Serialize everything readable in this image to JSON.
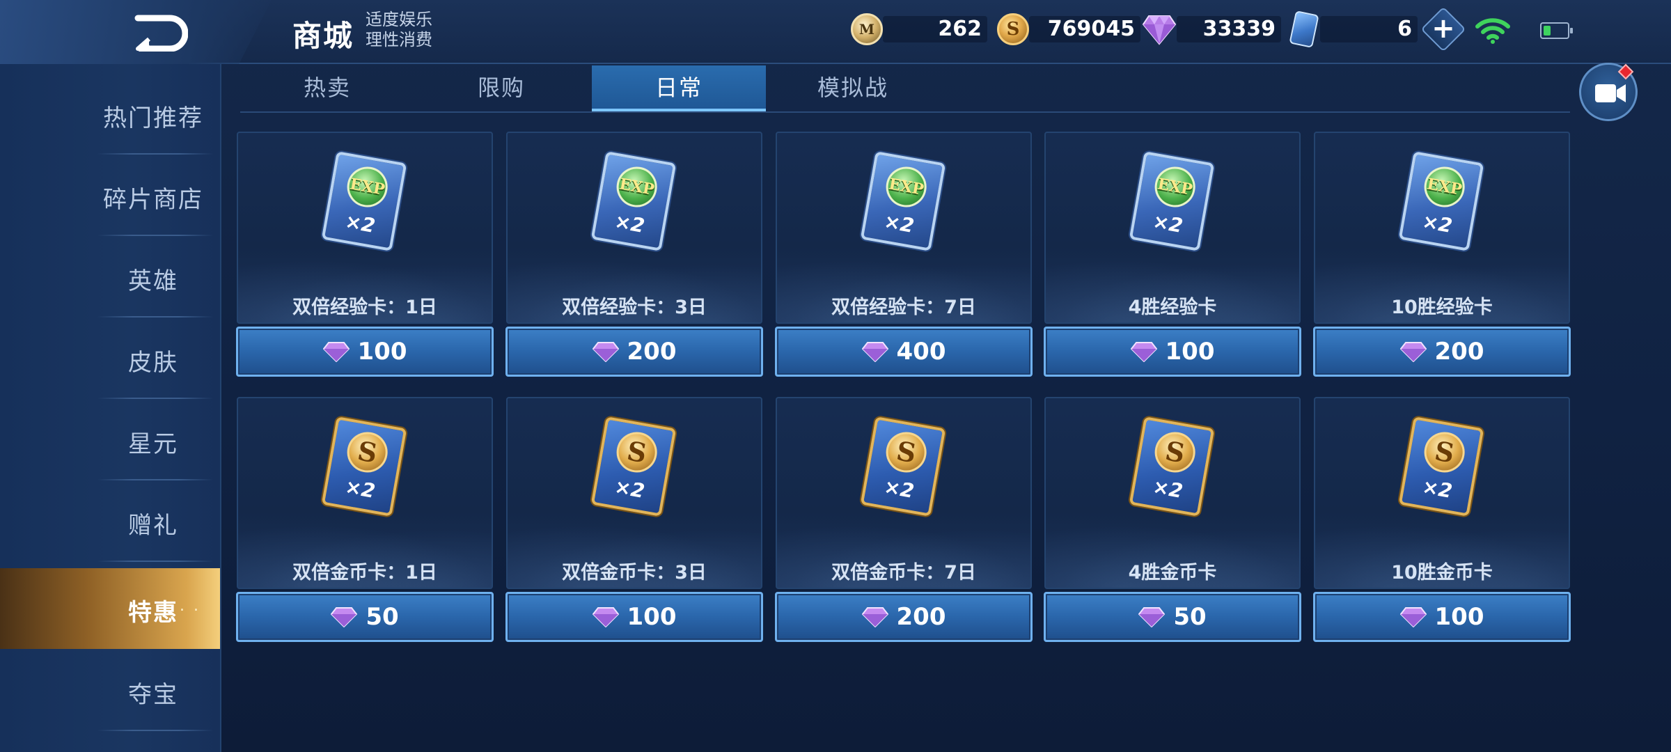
{
  "header": {
    "title": "商城",
    "notice_line1": "适度娱乐",
    "notice_line2": "理性消费",
    "currencies": {
      "token": "262",
      "gold": "769045",
      "diamond": "33339",
      "ticket": "6"
    }
  },
  "tabs": [
    "热卖",
    "限购",
    "日常",
    "模拟战"
  ],
  "active_tab": "日常",
  "sidebar": [
    "热门推荐",
    "碎片商店",
    "英雄",
    "皮肤",
    "星元",
    "赠礼",
    "特惠",
    "夺宝"
  ],
  "active_sidebar": "特惠",
  "token_glyph": "M",
  "item_icons": {
    "exp_emblem": "EXP",
    "gold_emblem": "S",
    "multiplier": "×2"
  },
  "items": [
    {
      "name": "双倍经验卡：1日",
      "price": "100",
      "icon": "exp-card-icon"
    },
    {
      "name": "双倍经验卡：3日",
      "price": "200",
      "icon": "exp-card-icon"
    },
    {
      "name": "双倍经验卡：7日",
      "price": "400",
      "icon": "exp-card-icon"
    },
    {
      "name": "4胜经验卡",
      "price": "100",
      "icon": "exp-card-icon"
    },
    {
      "name": "10胜经验卡",
      "price": "200",
      "icon": "exp-card-icon"
    },
    {
      "name": "双倍金币卡：1日",
      "price": "50",
      "icon": "gold-card-icon"
    },
    {
      "name": "双倍金币卡：3日",
      "price": "100",
      "icon": "gold-card-icon"
    },
    {
      "name": "双倍金币卡：7日",
      "price": "200",
      "icon": "gold-card-icon"
    },
    {
      "name": "4胜金币卡",
      "price": "50",
      "icon": "gold-card-icon"
    },
    {
      "name": "10胜金币卡",
      "price": "100",
      "icon": "gold-card-icon"
    }
  ],
  "colors": {
    "accent_tab": "#2a6cae",
    "active_sidebar": "#d9a54e",
    "price_button": "#2a66ab",
    "diamond": "#c58af0"
  }
}
